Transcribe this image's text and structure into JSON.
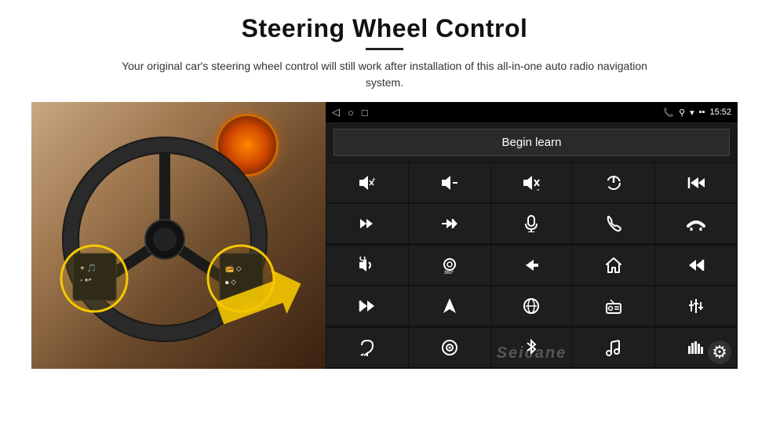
{
  "page": {
    "title": "Steering Wheel Control",
    "subtitle": "Your original car's steering wheel control will still work after installation of this all-in-one auto radio navigation system.",
    "divider": true
  },
  "status_bar": {
    "left_icons": [
      "◁",
      "○",
      "□"
    ],
    "signal_icons": "▪▪",
    "right_icons": "📞 ⚲ ▼",
    "time": "15:52"
  },
  "begin_learn_button": {
    "label": "Begin learn"
  },
  "controls": {
    "rows": [
      [
        {
          "icon": "🔊+",
          "name": "vol-up"
        },
        {
          "icon": "🔊-",
          "name": "vol-down"
        },
        {
          "icon": "🔇",
          "name": "mute"
        },
        {
          "icon": "⏻",
          "name": "power"
        },
        {
          "icon": "⏮",
          "name": "prev-track"
        }
      ],
      [
        {
          "icon": "⏭",
          "name": "next"
        },
        {
          "icon": "⏩",
          "name": "fast-forward"
        },
        {
          "icon": "🎤",
          "name": "mic"
        },
        {
          "icon": "📞",
          "name": "phone"
        },
        {
          "icon": "📵",
          "name": "hang-up"
        }
      ],
      [
        {
          "icon": "📣",
          "name": "speaker"
        },
        {
          "icon": "🔄",
          "name": "360"
        },
        {
          "icon": "↩",
          "name": "back"
        },
        {
          "icon": "⌂",
          "name": "home"
        },
        {
          "icon": "⏮⏮",
          "name": "rewind"
        }
      ],
      [
        {
          "icon": "⏭⏭",
          "name": "skip-fwd"
        },
        {
          "icon": "▶",
          "name": "nav"
        },
        {
          "icon": "⊕",
          "name": "mode"
        },
        {
          "icon": "📻",
          "name": "radio"
        },
        {
          "icon": "⚙",
          "name": "eq"
        }
      ],
      [
        {
          "icon": "🎙",
          "name": "voice"
        },
        {
          "icon": "🔘",
          "name": "knob"
        },
        {
          "icon": "✱",
          "name": "bluetooth"
        },
        {
          "icon": "🎵",
          "name": "music"
        },
        {
          "icon": "📊",
          "name": "spectrum"
        }
      ]
    ]
  },
  "watermark": {
    "text": "Seicane"
  },
  "gear_icon": "⚙"
}
